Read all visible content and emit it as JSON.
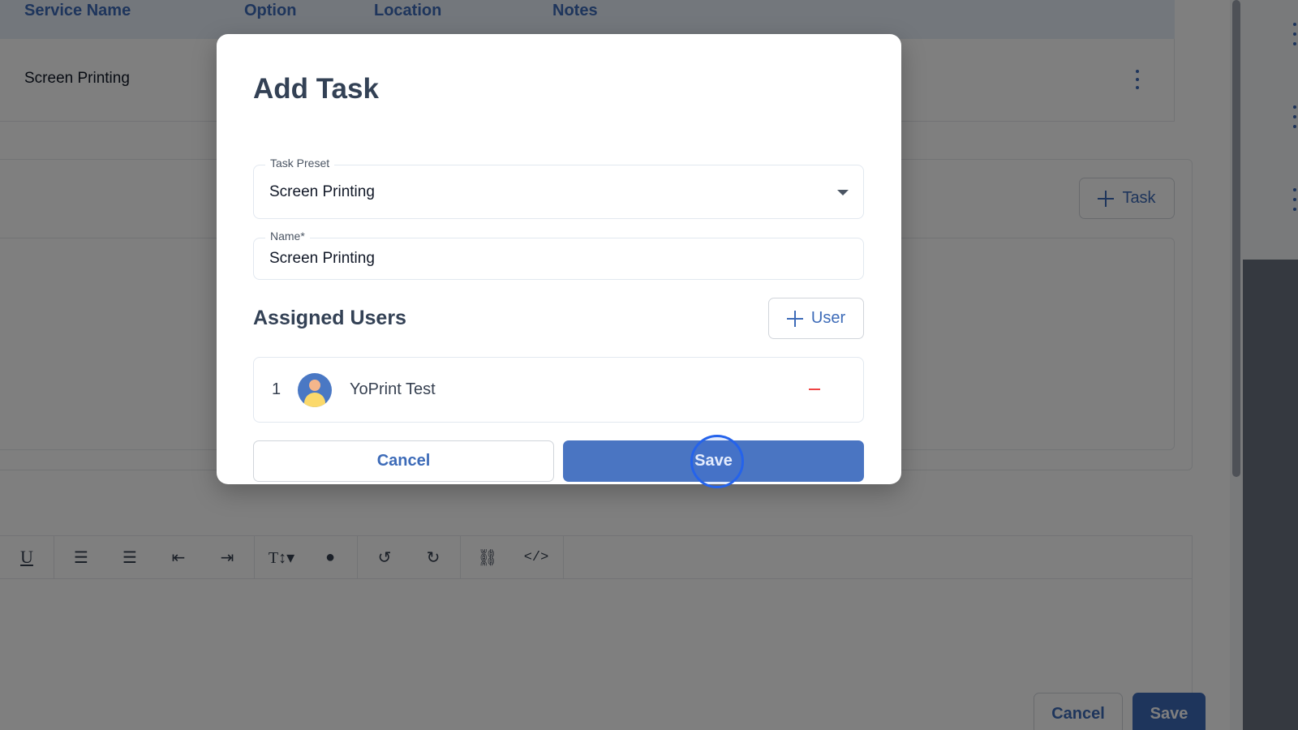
{
  "background": {
    "table": {
      "headers": [
        "Service Name",
        "Option",
        "Location",
        "Notes"
      ],
      "rows": [
        {
          "service_name": "Screen Printing"
        }
      ]
    },
    "add_task_button": {
      "icon": "plus-icon",
      "label": "Task"
    },
    "editor_toolbar": {
      "icons": [
        "underline-icon",
        "ordered-list-icon",
        "bullet-list-icon",
        "outdent-icon",
        "indent-icon",
        "text-size-icon",
        "color-drop-icon",
        "undo-icon",
        "redo-icon",
        "link-icon",
        "code-icon"
      ]
    },
    "footer": {
      "cancel_label": "Cancel",
      "save_label": "Save"
    }
  },
  "modal": {
    "title": "Add Task",
    "task_preset": {
      "label": "Task Preset",
      "value": "Screen Printing"
    },
    "name_field": {
      "label": "Name",
      "required_mark": "*",
      "value": "Screen Printing"
    },
    "assigned_users": {
      "title": "Assigned Users",
      "add_user_label": "User",
      "users": [
        {
          "index": "1",
          "name": "YoPrint Test"
        }
      ]
    },
    "cancel_label": "Cancel",
    "save_label": "Save"
  },
  "colors": {
    "accent": "#3d6bb8",
    "primary_button": "#4a75c2",
    "danger": "#ef4444",
    "overlay": "rgba(0,0,0,0.5)"
  }
}
